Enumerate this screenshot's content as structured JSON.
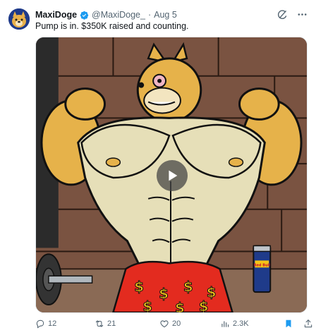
{
  "author": {
    "name": "MaxiDoge",
    "handle": "@MaxiDoge_",
    "separator": "·",
    "date": "Aug 5",
    "verified": true
  },
  "tweet": {
    "text": "Pump is in. $350K raised and counting."
  },
  "media": {
    "type": "video",
    "can_label": "Red Bull",
    "shirt_symbol": "$"
  },
  "actions": {
    "reply_count": "12",
    "retweet_count": "21",
    "like_count": "20",
    "view_count": "2.3K"
  },
  "colors": {
    "accent": "#1d9bf0",
    "muted": "#536471",
    "shirt_red": "#e32b1f",
    "dollar_gold": "#f5c518",
    "wall_brick": "#7a5341"
  },
  "icons": {
    "verified": "verified-badge-icon",
    "grok": "grok-icon",
    "more": "more-icon",
    "play": "play-icon",
    "reply": "reply-icon",
    "retweet": "retweet-icon",
    "like": "like-icon",
    "views": "views-icon",
    "bookmark": "bookmark-icon",
    "share": "share-icon"
  }
}
